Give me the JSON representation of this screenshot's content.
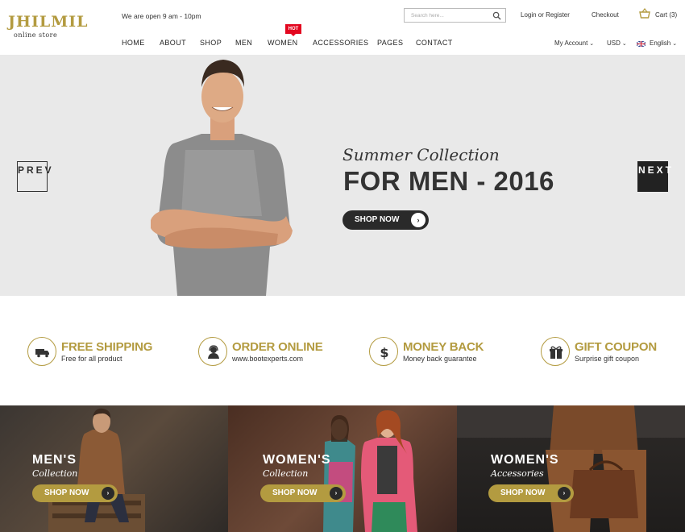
{
  "header": {
    "logo_main": "JHILMIL",
    "logo_sub": "online store",
    "open_hours": "We are open 9 am - 10pm",
    "search_placeholder": "Search here...",
    "login_label": "Login or Register",
    "checkout_label": "Checkout",
    "cart_label": "Cart (3)"
  },
  "nav": {
    "items": [
      "HOME",
      "ABOUT",
      "SHOP",
      "MEN",
      "WOMEN",
      "ACCESSORIES",
      "PAGES",
      "CONTACT"
    ],
    "hot_badge": "HOT",
    "account_label": "My Account",
    "currency_label": "USD",
    "language_label": "English"
  },
  "hero": {
    "prev_label": "PREV",
    "next_label": "NEXT",
    "subtitle": "Summer Collection",
    "title": "FOR MEN - 2016",
    "button_label": "SHOP NOW"
  },
  "features": [
    {
      "title": "FREE SHIPPING",
      "subtitle": "Free for all product",
      "icon": "truck-icon"
    },
    {
      "title": "ORDER ONLINE",
      "subtitle": "www.bootexperts.com",
      "icon": "support-icon"
    },
    {
      "title": "MONEY BACK",
      "subtitle": "Money back guarantee",
      "icon": "dollar-icon"
    },
    {
      "title": "GIFT COUPON",
      "subtitle": "Surprise gift coupon",
      "icon": "gift-icon"
    }
  ],
  "banners": [
    {
      "title": "MEN'S",
      "subtitle": "Collection",
      "button_label": "SHOP NOW"
    },
    {
      "title": "WOMEN'S",
      "subtitle": "Collection",
      "button_label": "SHOP NOW"
    },
    {
      "title": "WOMEN'S",
      "subtitle": "Accessories",
      "button_label": "SHOP NOW"
    }
  ],
  "colors": {
    "accent": "#b39b40",
    "hot": "#e3061f",
    "dark": "#2a2a2a"
  }
}
